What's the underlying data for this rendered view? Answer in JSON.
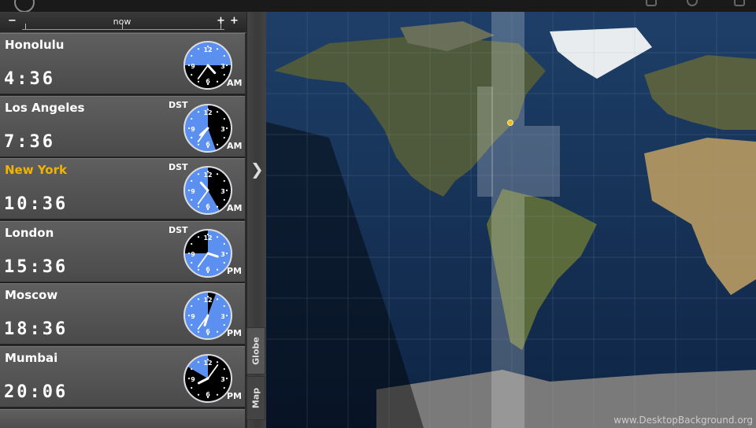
{
  "timebar": {
    "minus_label": "−",
    "plus_label": "+",
    "now_label": "now"
  },
  "cities": [
    {
      "name": "Honolulu",
      "time": "4:36",
      "ampm": "AM",
      "dst": "",
      "highlight": false,
      "hour": 4,
      "minute": 36,
      "dark_from": 90,
      "dark_to": 270
    },
    {
      "name": "Los Angeles",
      "time": "7:36",
      "ampm": "AM",
      "dst": "DST",
      "highlight": false,
      "hour": 7,
      "minute": 36,
      "dark_from": 0,
      "dark_to": 160
    },
    {
      "name": "New York",
      "time": "10:36",
      "ampm": "AM",
      "dst": "DST",
      "highlight": true,
      "hour": 10,
      "minute": 36,
      "dark_from": 0,
      "dark_to": 150
    },
    {
      "name": "London",
      "time": "15:36",
      "ampm": "PM",
      "dst": "DST",
      "highlight": false,
      "hour": 3,
      "minute": 36,
      "dark_from": 270,
      "dark_to": 360
    },
    {
      "name": "Moscow",
      "time": "18:36",
      "ampm": "PM",
      "dst": "",
      "highlight": false,
      "hour": 6,
      "minute": 36,
      "dark_from": 0,
      "dark_to": 20
    },
    {
      "name": "Mumbai",
      "time": "20:06",
      "ampm": "PM",
      "dst": "",
      "highlight": false,
      "hour": 8,
      "minute": 6,
      "dark_from": 0,
      "dark_to": 300
    }
  ],
  "tabs": {
    "globe": "Globe",
    "map": "Map"
  },
  "watermark": "www.DesktopBackground.org",
  "colors": {
    "clock_day": "#5b8ff0",
    "clock_night": "#000000",
    "highlight": "#f0b400"
  }
}
